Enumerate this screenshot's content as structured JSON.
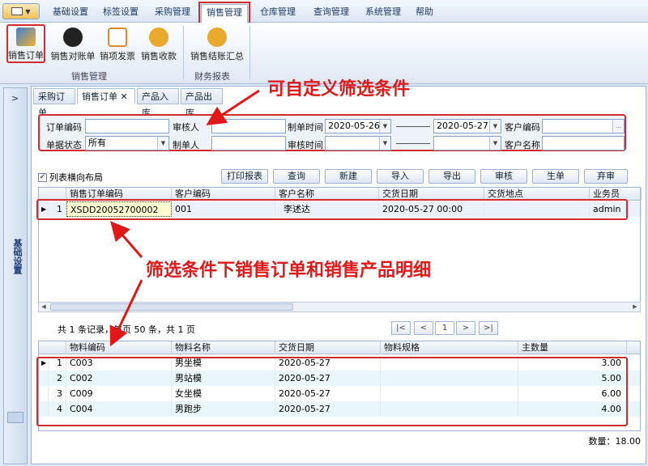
{
  "menu": {
    "tabs": [
      "基础设置",
      "标签设置",
      "采购管理",
      "销售管理",
      "仓库管理",
      "查询管理",
      "系统管理",
      "帮助"
    ],
    "active": "销售管理"
  },
  "ribbon": {
    "buttons": [
      "销售订单",
      "销售对账单",
      "销项发票",
      "销售收款",
      "销售结账汇总"
    ],
    "groups": [
      "销售管理",
      "财务报表"
    ]
  },
  "sidebar": {
    "label": "基础设置"
  },
  "doc_tabs": [
    "采购订单",
    "销售订单",
    "产品入库",
    "产品出库"
  ],
  "filter": {
    "order_no_label": "订单编码",
    "reviewer_label": "审核人",
    "create_time_label": "制单时间",
    "date_from": "2020-05-26",
    "date_to": "2020-05-27",
    "customer_code_label": "客户编码",
    "status_label": "单据状态",
    "status_value": "所有",
    "creator_label": "制单人",
    "review_time_label": "审核时间",
    "customer_name_label": "客户名称"
  },
  "horizontal_layout_label": "列表横向布局",
  "toolbar": [
    "打印报表",
    "查询",
    "新建",
    "导入",
    "导出",
    "审核",
    "生单",
    "弃审"
  ],
  "orders": {
    "columns": [
      "销售订单编码",
      "客户编码",
      "客户名称",
      "交货日期",
      "交货地点",
      "业务员"
    ],
    "rows": [
      {
        "idx": "1",
        "code": "XSDD20052700002",
        "customer_code": "001",
        "customer_name": "李述达",
        "delivery_date": "2020-05-27 00:00",
        "place": "",
        "salesman": "admin"
      }
    ]
  },
  "pager": {
    "summary": "共 1 条记录，每页 50 条，共 1 页",
    "page": "1",
    "first": "|<",
    "prev": "<",
    "next": ">",
    "last": ">|"
  },
  "details": {
    "columns": [
      "物料编码",
      "物料名称",
      "交货日期",
      "物料规格",
      "主数量"
    ],
    "rows": [
      {
        "idx": "1",
        "code": "C003",
        "name": "男坐模",
        "date": "2020-05-27",
        "spec": "",
        "qty": "3.00"
      },
      {
        "idx": "2",
        "code": "C002",
        "name": "男站模",
        "date": "2020-05-27",
        "spec": "",
        "qty": "5.00"
      },
      {
        "idx": "3",
        "code": "C009",
        "name": "女坐模",
        "date": "2020-05-27",
        "spec": "",
        "qty": "6.00"
      },
      {
        "idx": "4",
        "code": "C004",
        "name": "男跑步",
        "date": "2020-05-27",
        "spec": "",
        "qty": "4.00"
      }
    ]
  },
  "total_label": "数量：18.00",
  "annotations": {
    "top": "可自定义筛选条件",
    "middle": "筛选条件下销售订单和销售产品明细"
  },
  "colors": {
    "annotation": "#e01818",
    "selected_row": "#fffbd1",
    "alt_row": "#e9f7fb"
  }
}
